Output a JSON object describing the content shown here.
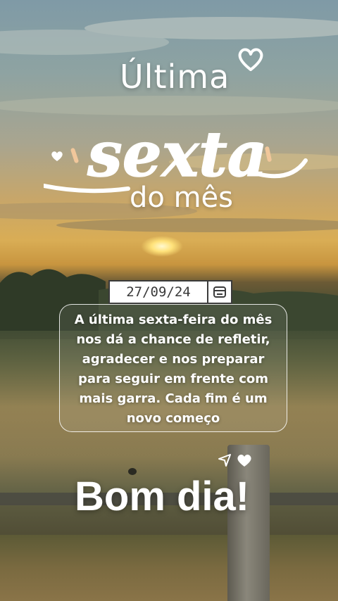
{
  "header": {
    "line1": "Última",
    "line2_script": "sexta",
    "line3": "do mês"
  },
  "date_card": {
    "date": "27/09/24",
    "icon": "calendar-icon"
  },
  "message": {
    "text": "A última sexta-feira do mês nos dá a chance de refletir, agradecer e nos preparar para seguir em frente com mais garra. Cada fim é um novo começo"
  },
  "footer": {
    "greeting": "Bom dia!",
    "icons": [
      "send-icon",
      "heart-icon"
    ]
  },
  "colors": {
    "text": "#ffffff",
    "accent_tick": "#f1c79b",
    "date_border": "#3b3b3b"
  }
}
